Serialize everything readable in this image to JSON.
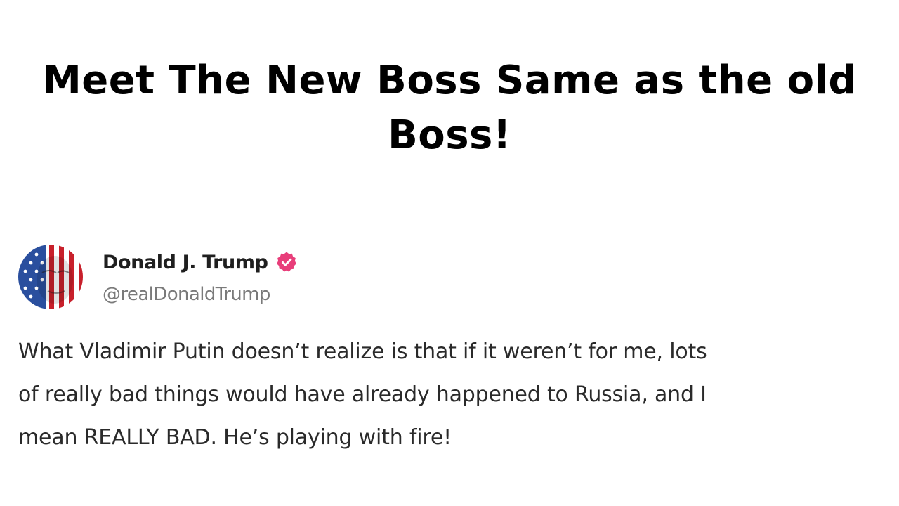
{
  "headline": {
    "line1": "Meet The New Boss Same as the old",
    "line2": "Boss!"
  },
  "post": {
    "display_name": "Donald J. Trump",
    "handle": "@realDonaldTrump",
    "verified_icon": "verified-badge-icon",
    "verified_color": "#e83e7a",
    "avatar_icon": "flag-face-avatar",
    "body_lines": [
      "What Vladimir Putin doesn’t realize is that if it weren’t for me, lots",
      "of really bad things would have already happened to Russia, and I",
      "mean REALLY BAD. He’s playing with fire!"
    ]
  }
}
